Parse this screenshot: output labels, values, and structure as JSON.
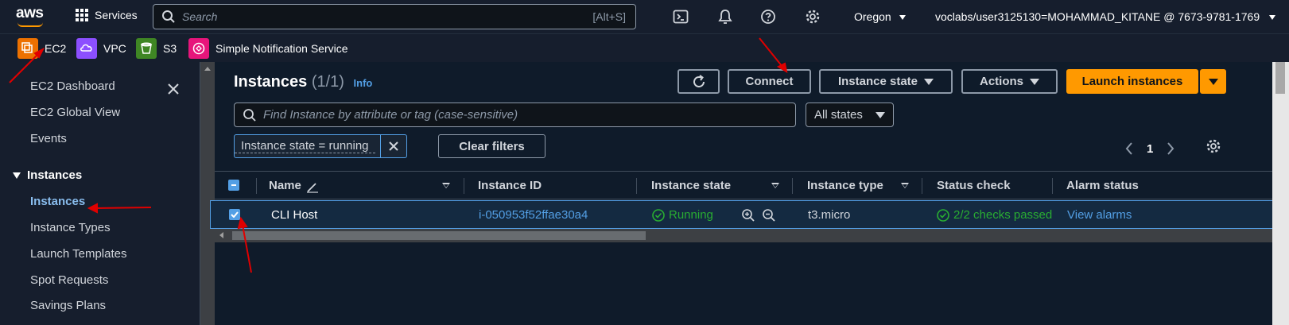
{
  "topnav": {
    "logo": "aws",
    "services_label": "Services",
    "search_placeholder": "Search",
    "search_hint": "[Alt+S]",
    "region": "Oregon",
    "account": "voclabs/user3125130=MOHAMMAD_KITANE @ 7673-9781-1769"
  },
  "favorites": [
    {
      "label": "EC2",
      "icon": "ec2-icon",
      "color": "#ed7100"
    },
    {
      "label": "VPC",
      "icon": "vpc-icon",
      "color": "#8c4fff"
    },
    {
      "label": "S3",
      "icon": "s3-icon",
      "color": "#3f8624"
    },
    {
      "label": "Simple Notification Service",
      "icon": "sns-icon",
      "color": "#e7157b"
    }
  ],
  "sidebar": {
    "items_top": [
      "EC2 Dashboard",
      "EC2 Global View",
      "Events"
    ],
    "section": "Instances",
    "section_items": [
      "Instances",
      "Instance Types",
      "Launch Templates",
      "Spot Requests",
      "Savings Plans"
    ]
  },
  "main": {
    "title": "Instances",
    "count": "(1/1)",
    "info": "Info",
    "buttons": {
      "connect": "Connect",
      "instance_state": "Instance state",
      "actions": "Actions",
      "launch": "Launch instances"
    },
    "filter_placeholder": "Find Instance by attribute or tag (case-sensitive)",
    "states_select": "All states",
    "token": "Instance state = running",
    "clear_filters": "Clear filters",
    "page": "1"
  },
  "table": {
    "columns": [
      "Name",
      "Instance ID",
      "Instance state",
      "Instance type",
      "Status check",
      "Alarm status"
    ],
    "rows": [
      {
        "name": "CLI Host",
        "instance_id": "i-050953f52ffae30a4",
        "state": "Running",
        "type": "t3.micro",
        "status_check": "2/2 checks passed",
        "alarm": "View alarms"
      }
    ]
  },
  "colors": {
    "accent": "#ff9900",
    "link": "#539fe5",
    "success": "#29ad32",
    "annotation": "#e00000"
  }
}
